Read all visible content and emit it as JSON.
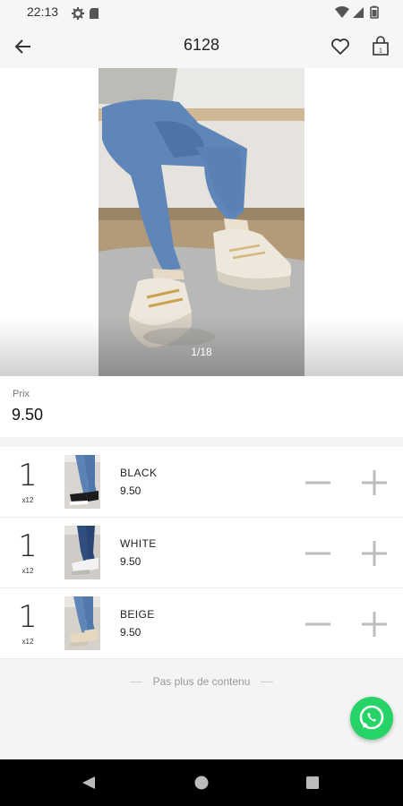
{
  "status_bar": {
    "time": "22:13",
    "icons": [
      "settings-icon",
      "sd-card-icon",
      "wifi-icon",
      "signal-icon",
      "battery-icon"
    ]
  },
  "app_bar": {
    "title": "6128",
    "icons": [
      "back-arrow-icon",
      "heart-icon",
      "shopping-bag-icon"
    ]
  },
  "gallery": {
    "counter": "1/18"
  },
  "price": {
    "label": "Prix",
    "value": "9.50"
  },
  "variants": [
    {
      "quantity": "1",
      "multiplier": "x12",
      "name": "BLACK",
      "price": "9.50",
      "shoe_color": "#1c1c1c"
    },
    {
      "quantity": "1",
      "multiplier": "x12",
      "name": "WHITE",
      "price": "9.50",
      "shoe_color": "#f2f2f2"
    },
    {
      "quantity": "1",
      "multiplier": "x12",
      "name": "BEIGE",
      "price": "9.50",
      "shoe_color": "#e6d8bf"
    }
  ],
  "footer": {
    "end_text": "Pas plus de contenu"
  },
  "colors": {
    "whatsapp_green": "#25d366",
    "stepper_gray": "#bdbdbd",
    "background": "#f4f4f4"
  }
}
